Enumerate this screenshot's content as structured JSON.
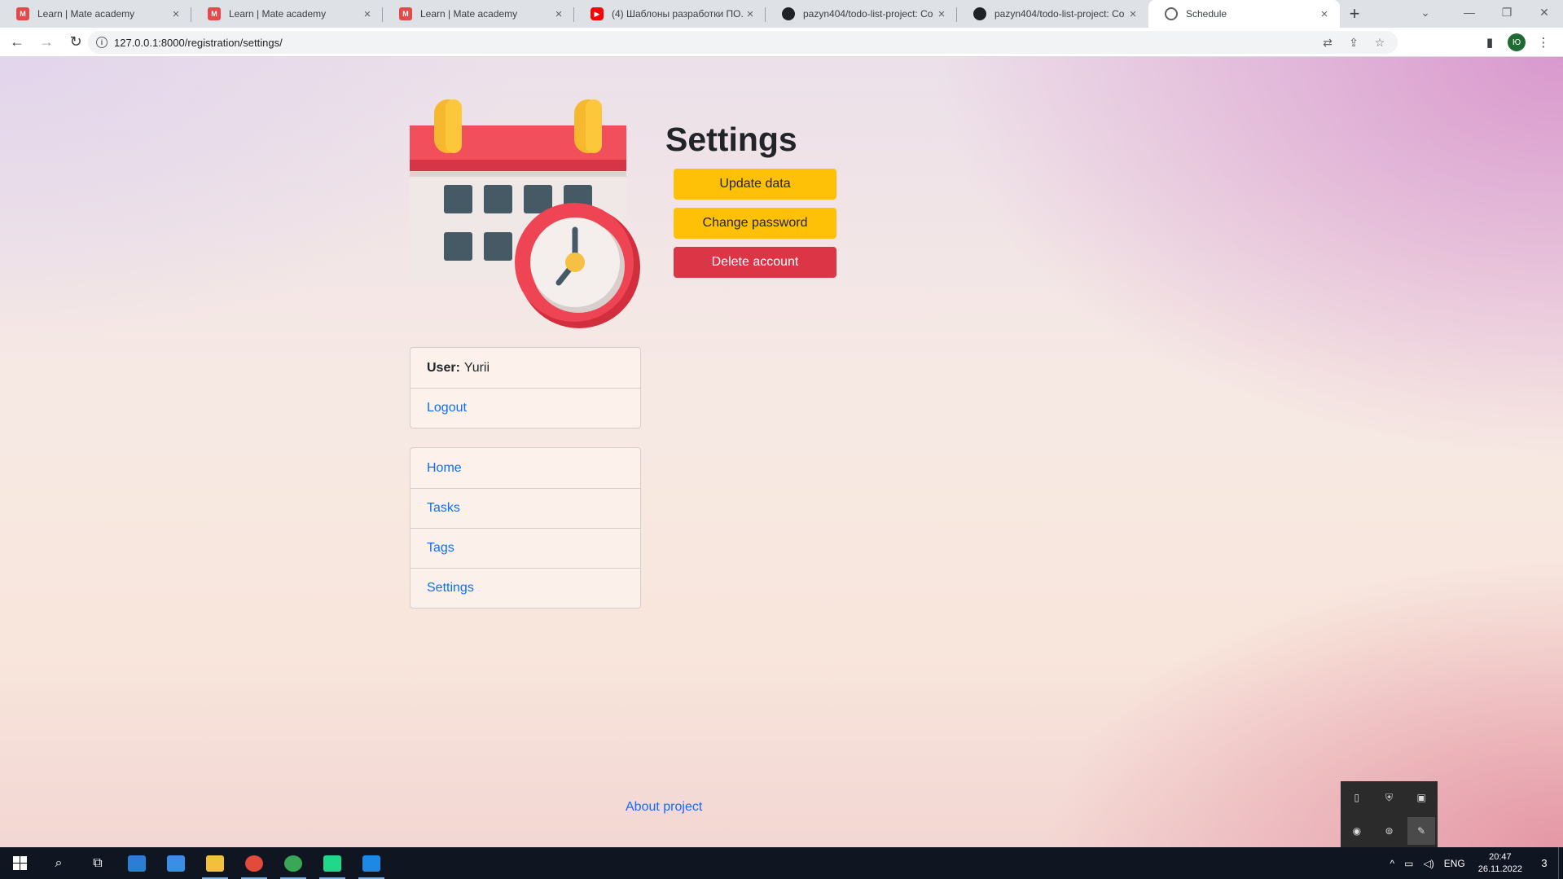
{
  "browser": {
    "tabs": [
      {
        "title": "Learn | Mate academy",
        "favicon": "mate-academy-icon",
        "active": false
      },
      {
        "title": "Learn | Mate academy",
        "favicon": "mate-academy-icon",
        "active": false
      },
      {
        "title": "Learn | Mate academy",
        "favicon": "mate-academy-icon",
        "active": false
      },
      {
        "title": "(4) Шаблоны разработки ПО. U",
        "favicon": "youtube-icon",
        "active": false
      },
      {
        "title": "pazyn404/todo-list-project: Co",
        "favicon": "github-icon",
        "active": false
      },
      {
        "title": "pazyn404/todo-list-project: Co",
        "favicon": "github-icon",
        "active": false
      },
      {
        "title": "Schedule",
        "favicon": "globe-icon",
        "active": true
      }
    ],
    "new_tab_glyph": "+",
    "url": "127.0.0.1:8000/registration/settings/",
    "profile_initial": "Ю"
  },
  "page": {
    "title": "Settings",
    "buttons": {
      "update": "Update data",
      "change_password": "Change password",
      "delete": "Delete account"
    },
    "user_card": {
      "user_label": "User:",
      "user_name": "Yurii",
      "logout": "Logout"
    },
    "nav": {
      "home": "Home",
      "tasks": "Tasks",
      "tags": "Tags",
      "settings": "Settings"
    },
    "footer_link": "About project"
  },
  "taskbar": {
    "language": "ENG",
    "time": "20:47",
    "date": "26.11.2022",
    "notifications": "3"
  },
  "colors": {
    "warning": "#ffc107",
    "danger": "#dc3545",
    "link": "#0d6efd"
  }
}
